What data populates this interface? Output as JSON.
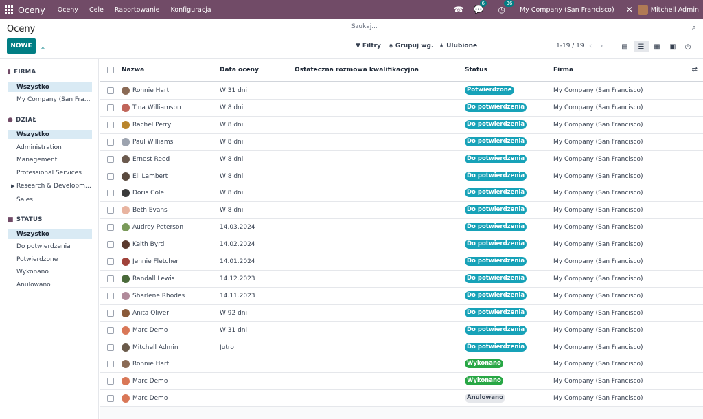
{
  "navbar": {
    "app_name": "Oceny",
    "menu": [
      "Oceny",
      "Cele",
      "Raportowanie",
      "Konfiguracja"
    ],
    "messages_count": "6",
    "activities_count": "36",
    "company": "My Company (San Francisco)",
    "user": "Mitchell Admin"
  },
  "control": {
    "title": "Oceny",
    "new_label": "NOWE",
    "search_placeholder": "Szukaj...",
    "filters_label": "Filtry",
    "groupby_label": "Grupuj wg.",
    "favorites_label": "Ulubione",
    "pager": "1-19 / 19"
  },
  "sidebar": {
    "firma": {
      "title": "FIRMA",
      "items": [
        "Wszystko",
        "My Company (San Francisco)"
      ]
    },
    "dzial": {
      "title": "DZIAŁ",
      "items": [
        "Wszystko",
        "Administration",
        "Management",
        "Professional Services",
        "Research & Development",
        "Sales"
      ]
    },
    "status": {
      "title": "STATUS",
      "items": [
        "Wszystko",
        "Do potwierdzenia",
        "Potwierdzone",
        "Wykonano",
        "Anulowano"
      ]
    }
  },
  "table": {
    "columns": [
      "Nazwa",
      "Data oceny",
      "Ostateczna rozmowa kwalifikacyjna",
      "Status",
      "Firma"
    ],
    "rows": [
      {
        "name": "Ronnie Hart",
        "date": "W 31 dni",
        "final": "",
        "status": "Potwierdzone",
        "status_type": "info",
        "company": "My Company (San Francisco)",
        "avatar_color": "#8a6a55"
      },
      {
        "name": "Tina Williamson",
        "date": "W 8 dni",
        "final": "",
        "status": "Do potwierdzenia",
        "status_type": "info",
        "company": "My Company (San Francisco)",
        "avatar_color": "#c0655a"
      },
      {
        "name": "Rachel Perry",
        "date": "W 8 dni",
        "final": "",
        "status": "Do potwierdzenia",
        "status_type": "info",
        "company": "My Company (San Francisco)",
        "avatar_color": "#b9852c"
      },
      {
        "name": "Paul Williams",
        "date": "W 8 dni",
        "final": "",
        "status": "Do potwierdzenia",
        "status_type": "info",
        "company": "My Company (San Francisco)",
        "avatar_color": "#9ca3af"
      },
      {
        "name": "Ernest Reed",
        "date": "W 8 dni",
        "final": "",
        "status": "Do potwierdzenia",
        "status_type": "info",
        "company": "My Company (San Francisco)",
        "avatar_color": "#6b5a4e"
      },
      {
        "name": "Eli Lambert",
        "date": "W 8 dni",
        "final": "",
        "status": "Do potwierdzenia",
        "status_type": "info",
        "company": "My Company (San Francisco)",
        "avatar_color": "#5a4a3e"
      },
      {
        "name": "Doris Cole",
        "date": "W 8 dni",
        "final": "",
        "status": "Do potwierdzenia",
        "status_type": "info",
        "company": "My Company (San Francisco)",
        "avatar_color": "#3a3a3a"
      },
      {
        "name": "Beth Evans",
        "date": "W 8 dni",
        "final": "",
        "status": "Do potwierdzenia",
        "status_type": "info",
        "company": "My Company (San Francisco)",
        "avatar_color": "#e8b4a0"
      },
      {
        "name": "Audrey Peterson",
        "date": "14.03.2024",
        "final": "",
        "status": "Do potwierdzenia",
        "status_type": "info",
        "company": "My Company (San Francisco)",
        "avatar_color": "#7a9a5a"
      },
      {
        "name": "Keith Byrd",
        "date": "14.02.2024",
        "final": "",
        "status": "Do potwierdzenia",
        "status_type": "info",
        "company": "My Company (San Francisco)",
        "avatar_color": "#5a3a2e"
      },
      {
        "name": "Jennie Fletcher",
        "date": "14.01.2024",
        "final": "",
        "status": "Do potwierdzenia",
        "status_type": "info",
        "company": "My Company (San Francisco)",
        "avatar_color": "#a0423a"
      },
      {
        "name": "Randall Lewis",
        "date": "14.12.2023",
        "final": "",
        "status": "Do potwierdzenia",
        "status_type": "info",
        "company": "My Company (San Francisco)",
        "avatar_color": "#4a6a3a"
      },
      {
        "name": "Sharlene Rhodes",
        "date": "14.11.2023",
        "final": "",
        "status": "Do potwierdzenia",
        "status_type": "info",
        "company": "My Company (San Francisco)",
        "avatar_color": "#b08a9a"
      },
      {
        "name": "Anita Oliver",
        "date": "W 92 dni",
        "final": "",
        "status": "Do potwierdzenia",
        "status_type": "info",
        "company": "My Company (San Francisco)",
        "avatar_color": "#8a5a3a"
      },
      {
        "name": "Marc Demo",
        "date": "W 31 dni",
        "final": "",
        "status": "Do potwierdzenia",
        "status_type": "info",
        "company": "My Company (San Francisco)",
        "avatar_color": "#d97757"
      },
      {
        "name": "Mitchell Admin",
        "date": "Jutro",
        "final": "",
        "status": "Do potwierdzenia",
        "status_type": "info",
        "company": "My Company (San Francisco)",
        "avatar_color": "#6a5a4a"
      },
      {
        "name": "Ronnie Hart",
        "date": "",
        "final": "",
        "status": "Wykonano",
        "status_type": "success",
        "company": "My Company (San Francisco)",
        "avatar_color": "#8a6a55"
      },
      {
        "name": "Marc Demo",
        "date": "",
        "final": "",
        "status": "Wykonano",
        "status_type": "success",
        "company": "My Company (San Francisco)",
        "avatar_color": "#d97757"
      },
      {
        "name": "Marc Demo",
        "date": "",
        "final": "",
        "status": "Anulowano",
        "status_type": "muted",
        "company": "My Company (San Francisco)",
        "avatar_color": "#d97757"
      }
    ]
  },
  "colors": {
    "brand": "#714B67",
    "primary": "#017e84",
    "info_badge": "#17a2b8",
    "success_badge": "#28a745"
  },
  "icons": {
    "apps": "apps-grid-icon",
    "phone": "phone-icon",
    "chat": "chat-icon",
    "clock": "clock-icon",
    "tools": "tools-icon",
    "download": "download-icon",
    "search": "search-icon",
    "filter": "filter-icon",
    "layers": "layers-icon",
    "star": "star-icon",
    "kanban": "kanban-view-icon",
    "list": "list-view-icon",
    "activity": "activity-view-icon",
    "calendar": "calendar-view-icon",
    "settings": "optional-columns-icon"
  }
}
